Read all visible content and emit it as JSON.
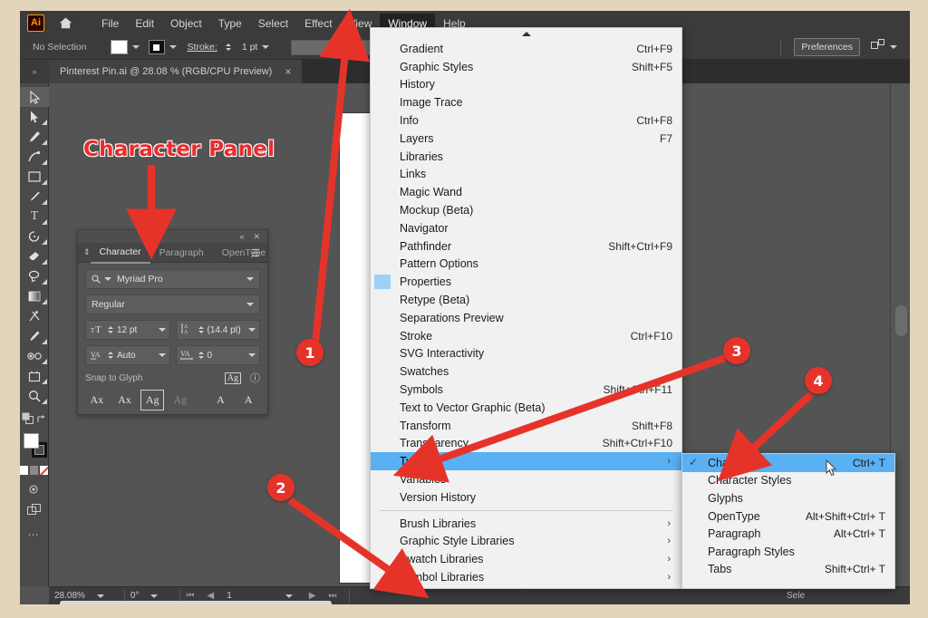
{
  "app": {
    "logo": "Ai",
    "home_icon": "home-icon",
    "menus": [
      "File",
      "Edit",
      "Object",
      "Type",
      "Select",
      "Effect",
      "View",
      "Window",
      "Help"
    ],
    "active_menu": "Window"
  },
  "controlbar": {
    "selection_status": "No Selection",
    "fill_swatch": "white",
    "stroke_swatch": "black",
    "stroke_label": "Stroke:",
    "stroke_weight": "1 pt",
    "preferences_label": "Preferences"
  },
  "document_tab": {
    "title": "Pinterest Pin.ai @ 28.08 % (RGB/CPU Preview)",
    "close_icon": "×"
  },
  "tools": [
    {
      "name": "selection-tool",
      "glyph": "selection",
      "selected": true
    },
    {
      "name": "direct-selection-tool",
      "glyph": "direct-selection",
      "selected": false
    },
    {
      "name": "pen-tool",
      "glyph": "pen",
      "selected": false
    },
    {
      "name": "curvature-tool",
      "glyph": "curvature",
      "selected": false
    },
    {
      "name": "rectangle-tool",
      "glyph": "rectangle",
      "selected": false
    },
    {
      "name": "paintbrush-tool",
      "glyph": "paintbrush",
      "selected": false
    },
    {
      "name": "type-tool",
      "glyph": "type",
      "selected": false
    },
    {
      "name": "rotate-tool",
      "glyph": "rotate",
      "selected": false
    },
    {
      "name": "eraser-tool",
      "glyph": "eraser",
      "selected": false
    },
    {
      "name": "lasso-tool",
      "glyph": "lasso",
      "selected": false
    },
    {
      "name": "gradient-tool",
      "glyph": "gradient",
      "selected": false
    },
    {
      "name": "puppet-warp-tool",
      "glyph": "puppet-warp",
      "selected": false
    },
    {
      "name": "eyedropper-tool",
      "glyph": "eyedropper",
      "selected": false
    },
    {
      "name": "blend-tool",
      "glyph": "blend",
      "selected": false
    },
    {
      "name": "shape-builder-tool",
      "glyph": "shape-builder",
      "selected": false
    },
    {
      "name": "artboard-tool",
      "glyph": "artboard",
      "selected": false
    },
    {
      "name": "zoom-tool",
      "glyph": "zoom",
      "selected": false
    }
  ],
  "character_panel": {
    "collapse_icon": "«",
    "close_icon": "✕",
    "menu_icon": "☰",
    "tabs": [
      "Character",
      "Paragraph",
      "OpenType"
    ],
    "active_tab": "Character",
    "font_family": "Myriad Pro",
    "font_style": "Regular",
    "font_size": "12 pt",
    "leading": "(14.4 pt)",
    "kerning": "Auto",
    "tracking": "0",
    "snap_to_glyph_label": "Snap to Glyph",
    "glyph_buttons": [
      "Ax",
      "Ax",
      "Ag",
      "Ag",
      "A",
      "A"
    ]
  },
  "window_menu": {
    "items": [
      {
        "label": "Gradient",
        "shortcut": "Ctrl+F9"
      },
      {
        "label": "Graphic Styles",
        "shortcut": "Shift+F5"
      },
      {
        "label": "History",
        "shortcut": ""
      },
      {
        "label": "Image Trace",
        "shortcut": ""
      },
      {
        "label": "Info",
        "shortcut": "Ctrl+F8"
      },
      {
        "label": "Layers",
        "shortcut": "F7"
      },
      {
        "label": "Libraries",
        "shortcut": ""
      },
      {
        "label": "Links",
        "shortcut": ""
      },
      {
        "label": "Magic Wand",
        "shortcut": ""
      },
      {
        "label": "Mockup (Beta)",
        "shortcut": ""
      },
      {
        "label": "Navigator",
        "shortcut": ""
      },
      {
        "label": "Pathfinder",
        "shortcut": "Shift+Ctrl+F9"
      },
      {
        "label": "Pattern Options",
        "shortcut": ""
      },
      {
        "label": "Properties",
        "shortcut": "",
        "checked": true
      },
      {
        "label": "Retype (Beta)",
        "shortcut": ""
      },
      {
        "label": "Separations Preview",
        "shortcut": ""
      },
      {
        "label": "Stroke",
        "shortcut": "Ctrl+F10"
      },
      {
        "label": "SVG Interactivity",
        "shortcut": ""
      },
      {
        "label": "Swatches",
        "shortcut": ""
      },
      {
        "label": "Symbols",
        "shortcut": "Shift+Ctrl+F11"
      },
      {
        "label": "Text to Vector Graphic (Beta)",
        "shortcut": ""
      },
      {
        "label": "Transform",
        "shortcut": "Shift+F8"
      },
      {
        "label": "Transparency",
        "shortcut": "Shift+Ctrl+F10"
      },
      {
        "label": "Type",
        "shortcut": "",
        "submenu": true,
        "selected": true
      },
      {
        "label": "Variables",
        "shortcut": ""
      },
      {
        "label": "Version History",
        "shortcut": ""
      }
    ],
    "library_items": [
      {
        "label": "Brush Libraries",
        "submenu": true
      },
      {
        "label": "Graphic Style Libraries",
        "submenu": true
      },
      {
        "label": "Swatch Libraries",
        "submenu": true
      },
      {
        "label": "Symbol Libraries",
        "submenu": true
      }
    ],
    "submenu_arrow": "›"
  },
  "type_submenu": {
    "items": [
      {
        "label": "Character",
        "shortcut": "Ctrl+ T",
        "checked": true,
        "selected": true
      },
      {
        "label": "Character Styles",
        "shortcut": ""
      },
      {
        "label": "Glyphs",
        "shortcut": ""
      },
      {
        "label": "OpenType",
        "shortcut": "Alt+Shift+Ctrl+ T"
      },
      {
        "label": "Paragraph",
        "shortcut": "Alt+Ctrl+ T"
      },
      {
        "label": "Paragraph Styles",
        "shortcut": ""
      },
      {
        "label": "Tabs",
        "shortcut": "Shift+Ctrl+ T"
      }
    ]
  },
  "statusbar": {
    "zoom_level": "28.08%",
    "rotation": "0°",
    "artboard_number": "1",
    "tool_status": "Sele"
  },
  "annotations": {
    "title": "Character Panel",
    "badges": [
      "1",
      "2",
      "3",
      "4"
    ],
    "accent_color": "#e6332a",
    "highlight_color": "#59b0f2"
  }
}
